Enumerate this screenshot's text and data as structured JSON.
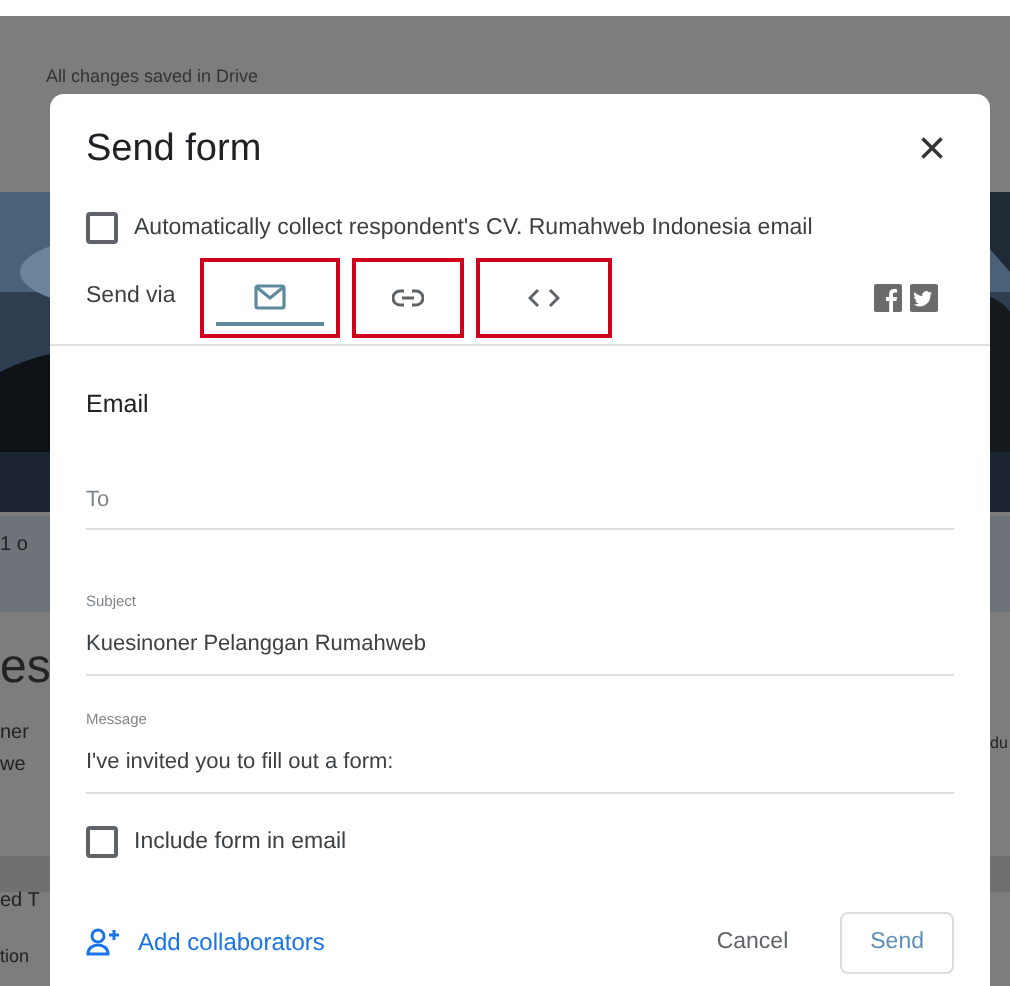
{
  "background": {
    "status": "All changes saved in Drive",
    "fragments": [
      {
        "text": "1 o",
        "kind": "small"
      },
      {
        "text": "es",
        "kind": "large"
      },
      {
        "text": "ner",
        "kind": "small"
      },
      {
        "text": "we",
        "kind": "small"
      },
      {
        "text": "ed T",
        "kind": "small"
      },
      {
        "text": "tion",
        "kind": "tiny"
      },
      {
        "text": "du",
        "kind": "right"
      }
    ]
  },
  "dialog": {
    "title": "Send form",
    "close": "×",
    "collect_email": {
      "label": "Automatically collect respondent's CV. Rumahweb Indonesia email",
      "checked": false
    },
    "send_via": {
      "label": "Send via",
      "tabs": [
        {
          "kind": "email",
          "selected": true,
          "highlighted": true
        },
        {
          "kind": "link",
          "selected": false,
          "highlighted": true
        },
        {
          "kind": "embed",
          "selected": false,
          "highlighted": true
        }
      ]
    },
    "section_title": "Email",
    "to": {
      "placeholder": "To"
    },
    "subject": {
      "label": "Subject",
      "value": "Kuesinoner Pelanggan Rumahweb"
    },
    "message": {
      "label": "Message",
      "value": "I've invited you to fill out a form:"
    },
    "include_form": {
      "label": "Include form in email",
      "checked": false
    },
    "add_collaborators": "Add collaborators",
    "buttons": [
      {
        "label": "Cancel",
        "kind": "text"
      },
      {
        "label": "Send",
        "kind": "outlined"
      }
    ]
  }
}
